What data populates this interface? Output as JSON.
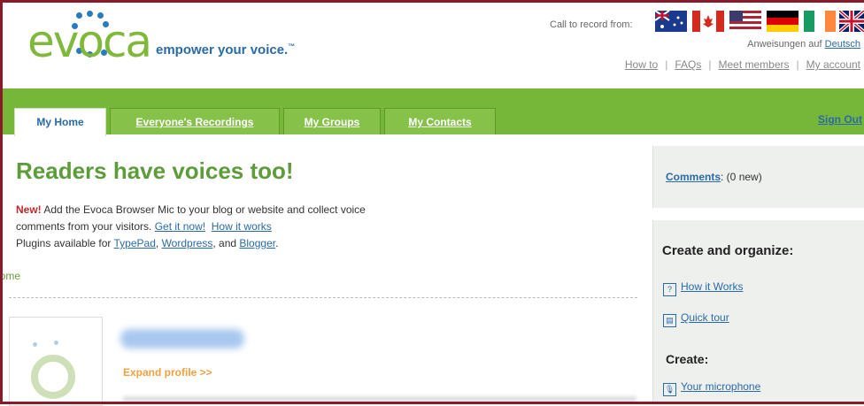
{
  "header": {
    "logo_text": "evoca",
    "tagline": "empower your voice.",
    "tagline_tm": "™",
    "call_label": "Call to record from:",
    "instructions_prefix": "Anweisungen auf",
    "instructions_link": "Deutsch",
    "top_links": [
      "How to",
      "FAQs",
      "Meet members",
      "My account"
    ],
    "flags": [
      "flag-australia-icon",
      "flag-canada-icon",
      "flag-usa-icon",
      "flag-germany-icon",
      "flag-ireland-icon",
      "flag-uk-icon"
    ]
  },
  "nav": {
    "tabs": [
      "My Home",
      "Everyone's Recordings",
      "My Groups",
      "My Contacts"
    ],
    "sign_out": "Sign Out"
  },
  "main": {
    "headline": "Readers have voices too!",
    "new_label": "New!",
    "intro_1": " Add the Evoca Browser Mic to your blog or website and collect voice",
    "intro_2": "comments from your visitors.",
    "get_it_now": "Get it now!",
    "how_it_works": "How it works",
    "plugins_prefix": "Plugins available for ",
    "typepad": "TypePad",
    "comma": ", ",
    "wordpress": "Wordpress",
    "and": ", and ",
    "blogger": "Blogger",
    "period": ".",
    "breadcrumb": "Home",
    "expand_profile": "Expand profile >>"
  },
  "sidebar": {
    "comments_link": "Comments",
    "comments_count": ": (0 new)",
    "create_organize": "Create and organize:",
    "how_it_works": "How it Works",
    "quick_tour": "Quick tour",
    "create": "Create:",
    "your_microphone": "Your microphone"
  },
  "colors": {
    "green": "#76b739",
    "headline_green": "#5c9c3a",
    "link_blue": "#2a6aa8",
    "orange": "#f0a040",
    "new_red": "#c0282b"
  }
}
